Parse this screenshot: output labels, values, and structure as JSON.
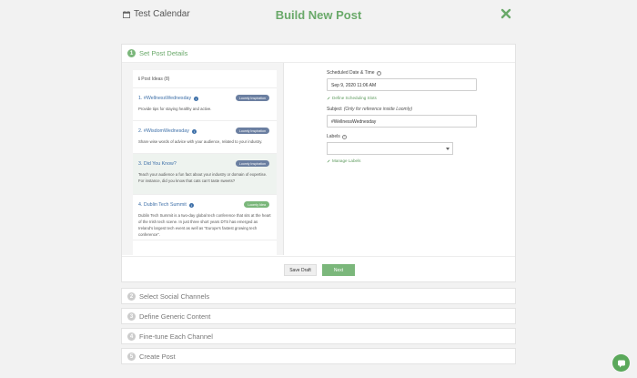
{
  "topbar": {
    "calendar_title": "Test Calendar",
    "page_title": "Build New Post"
  },
  "steps": [
    {
      "number": "1",
      "label": "Set Post Details",
      "active": true
    },
    {
      "number": "2",
      "label": "Select Social Channels"
    },
    {
      "number": "3",
      "label": "Define Generic Content"
    },
    {
      "number": "4",
      "label": "Fine-tune Each Channel"
    },
    {
      "number": "5",
      "label": "Create Post"
    }
  ],
  "post_ideas": {
    "header": "Post Ideas (8)",
    "items": [
      {
        "title": "1. #WellnessWednesday",
        "badge": "Loomly Inspiration",
        "badge_color": "#6b7fa1",
        "description": "Provide tips for staying healthy and active."
      },
      {
        "title": "2. #WisdomWednesday",
        "badge": "Loomly Inspiration",
        "badge_color": "#6b7fa1",
        "description": "Share wise words of advice with your audience, related to your industry."
      },
      {
        "title": "3. Did You Know?",
        "badge": "Loomly Inspiration",
        "badge_color": "#6b7fa1",
        "description": "Teach your audience a fun fact about your industry or domain of expertise. For instance, did you know that cats can't taste sweets?"
      },
      {
        "title": "4. Dublin Tech Summit",
        "badge": "Loomly Idea",
        "badge_color": "#7bb77b",
        "description": "Dublin Tech Summit is a two-day global tech conference that sits at the heart of the Irish tech scene. In just three short years DTS has emerged as Ireland's largest tech event as well as \"Europe's fastest growing tech conference\"."
      }
    ]
  },
  "form": {
    "date_label": "Scheduled Date & Time",
    "date_value": "Sep 9, 2020 11:06 AM",
    "slots_link": "Define Scheduling Slots",
    "subject_label": "Subject",
    "subject_hint": "(Only for reference inside Loomly)",
    "subject_value": "#WellnessWednesday",
    "labels_label": "Labels",
    "labels_value": "",
    "manage_labels_link": "Manage Labels"
  },
  "buttons": {
    "save_draft": "Save Draft",
    "next": "Next"
  },
  "colors": {
    "accent": "#6aa96a",
    "badge_inspiration": "#6b7fa1",
    "badge_idea": "#7bb77b"
  }
}
